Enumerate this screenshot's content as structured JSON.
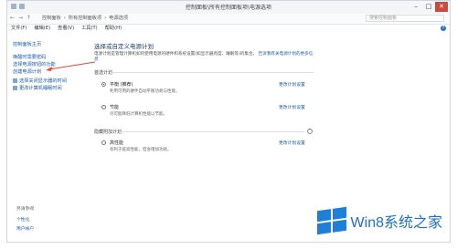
{
  "window": {
    "title": "控制面板\\所有控制面板项\\电源选项"
  },
  "address": {
    "crumbs": [
      "控制面板",
      "所有控制面板项",
      "电源选项"
    ],
    "search_placeholder": "搜索控制面板"
  },
  "menu": {
    "items": [
      "文件(F)",
      "编辑(E)",
      "查看(V)",
      "工具(T)",
      "帮助(H)"
    ]
  },
  "sidebar": {
    "home": "控制面板主页",
    "items": [
      "唤醒时需要密码",
      "选择电源按钮的功能",
      "创建电源计划",
      "选择关闭显示器的时间",
      "更改计算机睡眠时间"
    ]
  },
  "main": {
    "heading": "选择或自定义电源计划",
    "description": "电源计划是管理计算机如何使用电源的硬件和系统设置(如显示器亮度、睡眠等)的集合。",
    "description_link": "告诉我有关电源计划的更多信息",
    "preferred_title": "首选计划",
    "hidden_title": "隐藏附加计划",
    "change_link": "更改计划设置",
    "plans": [
      {
        "name": "平衡 (推荐)",
        "desc": "利用可用的硬件自动平衡功耗与性能。",
        "selected": true
      },
      {
        "name": "节能",
        "desc": "尽可能降低计算机性能以节能。",
        "selected": false
      },
      {
        "name": "高性能",
        "desc": "有利于提高性能，但会增加功耗。",
        "selected": false
      }
    ]
  },
  "see_also": {
    "title": "另请参阅",
    "items": [
      "个性化",
      "用户帐户"
    ]
  },
  "watermark": {
    "brand": "Win8系统之家",
    "color": "#1f7fd8"
  },
  "colors": {
    "link": "#1c5aa6",
    "close": "#c94a3f",
    "arrow": "#e04a3a"
  }
}
